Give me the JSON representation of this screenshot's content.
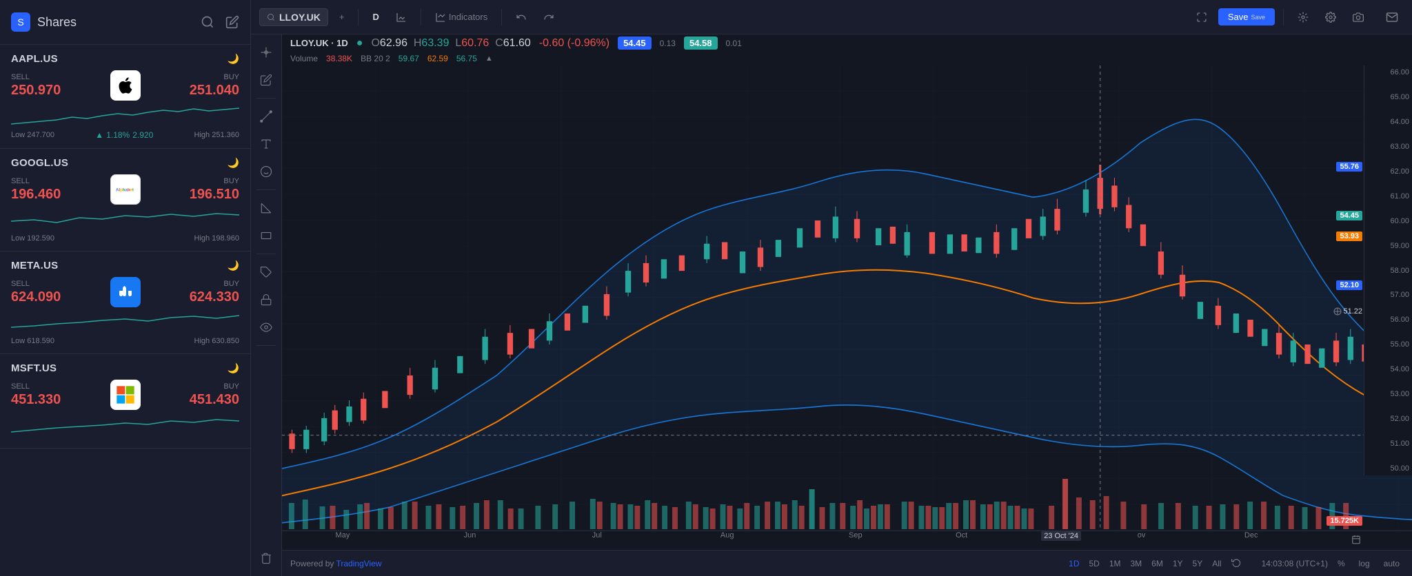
{
  "app": {
    "title": "Shares"
  },
  "sidebar": {
    "title": "Shares",
    "search_icon": "🔍",
    "edit_icon": "✏️",
    "stocks": [
      {
        "name": "AAPL.US",
        "sell_label": "SELL",
        "buy_label": "BUY",
        "sell_price": "250.970",
        "buy_price": "251.040",
        "low": "Low 247.700",
        "high": "High 251.360",
        "change": "1.18%",
        "change_pts": "2.920",
        "logo_text": "🍎"
      },
      {
        "name": "GOOGL.US",
        "sell_label": "SELL",
        "buy_label": "BUY",
        "sell_price": "196.460",
        "buy_price": "196.510",
        "low": "Low 192.590",
        "high": "High 198.960",
        "change": "",
        "change_pts": "",
        "logo_text": "G"
      },
      {
        "name": "META.US",
        "sell_label": "SELL",
        "buy_label": "BUY",
        "sell_price": "624.090",
        "buy_price": "624.330",
        "low": "Low 618.590",
        "high": "High 630.850",
        "change": "",
        "change_pts": "",
        "logo_text": "M"
      },
      {
        "name": "MSFT.US",
        "sell_label": "SELL",
        "buy_label": "BUY",
        "sell_price": "451.330",
        "buy_price": "451.430",
        "low": "",
        "high": "",
        "change": "",
        "change_pts": "",
        "logo_text": "⊞"
      }
    ]
  },
  "toolbar": {
    "symbol": "LLOY.UK",
    "add_icon": "+",
    "period": "D",
    "chart_type_icon": "📊",
    "indicators_label": "Indicators",
    "undo_icon": "↩",
    "redo_icon": "↪",
    "save_label": "Save",
    "save_dropdown": "▾"
  },
  "chart": {
    "symbol": "LLOY.UK · 1D",
    "dot": "●",
    "open_label": "O",
    "open_val": "62.96",
    "high_label": "H",
    "high_val": "63.39",
    "low_label": "L",
    "low_val": "60.76",
    "close_label": "C",
    "close_val": "61.60",
    "change": "-0.60 (-0.96%)",
    "price1": "54.45",
    "price2": "54.58",
    "price3": "0.13",
    "price4": "0.01",
    "volume_label": "Volume",
    "volume_val": "38.38K",
    "bb_label": "BB 20 2",
    "bb_val1": "59.67",
    "bb_val2": "62.59",
    "bb_val3": "56.75",
    "price_levels": [
      "66.00",
      "65.00",
      "64.00",
      "63.00",
      "62.00",
      "61.00",
      "60.00",
      "59.00",
      "58.00",
      "57.00",
      "56.00",
      "55.00",
      "54.00",
      "53.00",
      "52.00",
      "51.00",
      "50.00"
    ],
    "price_tags": {
      "p1": {
        "value": "55.76",
        "color": "blue"
      },
      "p2": {
        "value": "54.45",
        "color": "green"
      },
      "p3": {
        "value": "53.93",
        "color": "orange"
      },
      "p4": {
        "value": "52.10",
        "color": "blue"
      },
      "p5": {
        "value": "51.22",
        "color": "crosshair"
      },
      "p6": {
        "value": "15.725K",
        "color": "red"
      }
    },
    "x_labels": [
      "May",
      "Jun",
      "Jul",
      "Aug",
      "Sep",
      "Oct",
      "23 Oct '24",
      "ov",
      "Dec"
    ],
    "cursor_date": "23 Oct '24"
  },
  "timeframes": {
    "bottom": [
      "1D",
      "5D",
      "1M",
      "3M",
      "6M",
      "1Y",
      "5Y",
      "All"
    ],
    "active": "1D",
    "replay_icon": "⟳"
  },
  "bottom_bar": {
    "powered_by": "Powered by",
    "tradingview": "TradingView",
    "time": "14:03:08 (UTC+1)",
    "percent_label": "%",
    "log_label": "log",
    "auto_label": "auto"
  },
  "left_tools": [
    "✛",
    "✏️",
    "—",
    "⤢",
    "⌖",
    "😊",
    "📐",
    "🖊",
    "🔒",
    "👁",
    "🗑"
  ],
  "right_panel": [
    "⊞",
    "📷",
    "✉"
  ]
}
